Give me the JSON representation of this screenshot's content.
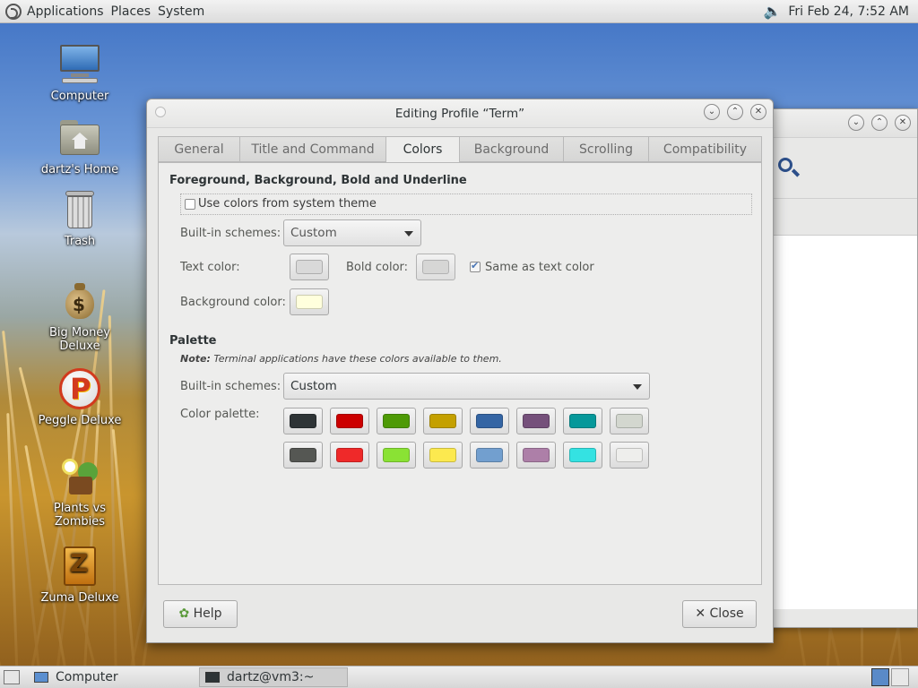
{
  "top_panel": {
    "menus": [
      "Applications",
      "Places",
      "System"
    ],
    "clock": "Fri Feb 24,  7:52 AM"
  },
  "desktop_icons": [
    {
      "label": "Computer",
      "icon": "computer-icon"
    },
    {
      "label": "dartz's Home",
      "icon": "home-folder-icon"
    },
    {
      "label": "Trash",
      "icon": "trash-icon"
    },
    {
      "label": "Big Money Deluxe",
      "icon": "money-bag-icon"
    },
    {
      "label": "Peggle Deluxe",
      "icon": "peggle-icon"
    },
    {
      "label": "Plants vs Zombies",
      "icon": "plants-icon"
    },
    {
      "label": "Zuma Deluxe",
      "icon": "zuma-icon"
    }
  ],
  "dialog": {
    "title": "Editing Profile “Term”",
    "tabs": [
      "General",
      "Title and Command",
      "Colors",
      "Background",
      "Scrolling",
      "Compatibility"
    ],
    "active_tab": "Colors",
    "fg_section": {
      "heading": "Foreground, Background, Bold and Underline",
      "use_system_theme_label": "Use colors from system theme",
      "use_system_theme_checked": false,
      "builtin_label": "Built-in schemes:",
      "builtin_value": "Custom",
      "text_color_label": "Text color:",
      "text_color": "#d9d9d9",
      "bold_color_label": "Bold color:",
      "bold_color": "#d2d2d2",
      "same_as_text_label": "Same as text color",
      "same_as_text_checked": true,
      "bg_color_label": "Background color:",
      "bg_color": "#ffffdd"
    },
    "palette_section": {
      "heading": "Palette",
      "note_bold": "Note:",
      "note_text": " Terminal applications have these colors available to them.",
      "builtin_label": "Built-in schemes:",
      "builtin_value": "Custom",
      "palette_label": "Color palette:",
      "row1": [
        "#2e3436",
        "#cc0000",
        "#4e9a06",
        "#c4a000",
        "#3465a4",
        "#75507b",
        "#06989a",
        "#d3d7cf"
      ],
      "row2": [
        "#555753",
        "#ef2929",
        "#8ae234",
        "#fce94f",
        "#729fcf",
        "#ad7fa8",
        "#34e2e2",
        "#eeeeec"
      ]
    },
    "help_label": "Help",
    "close_label": "Close"
  },
  "bottom_panel": {
    "tasks": [
      "Computer",
      "dartz@vm3:~"
    ]
  }
}
